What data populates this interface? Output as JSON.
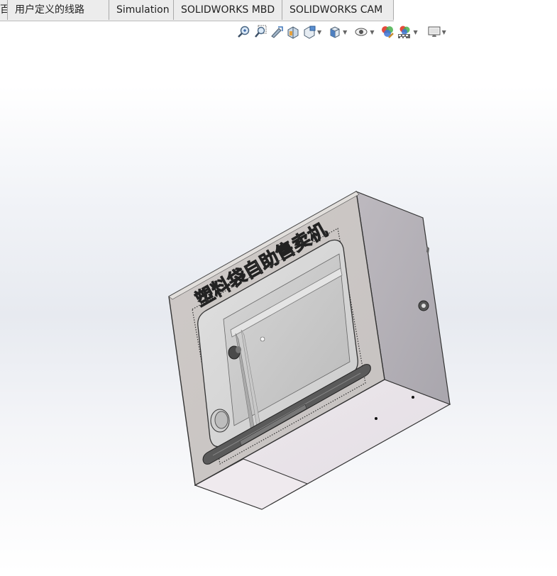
{
  "tabs": [
    {
      "label": "百"
    },
    {
      "label": "用户定义的线路"
    },
    {
      "label": "Simulation"
    },
    {
      "label": "SOLIDWORKS MBD"
    },
    {
      "label": "SOLIDWORKS CAM"
    }
  ],
  "headsup_toolbar": [
    {
      "icon": "zoom-to-fit-icon"
    },
    {
      "icon": "zoom-to-area-icon"
    },
    {
      "icon": "previous-view-icon"
    },
    {
      "icon": "section-view-icon"
    },
    {
      "icon": "dynamic-annotation-icon",
      "dropdown": true
    },
    {
      "icon": "view-orientation-icon",
      "dropdown": true
    },
    {
      "icon": "display-style-icon",
      "dropdown": true
    },
    {
      "icon": "edit-appearance-icon"
    },
    {
      "icon": "apply-scene-icon",
      "dropdown": true
    },
    {
      "icon": "view-settings-icon",
      "dropdown": true
    }
  ],
  "model": {
    "front_label": "塑料袋自助售卖机"
  },
  "colors": {
    "panel_front": "#cfcbc8",
    "panel_side": "#b4b0b5",
    "panel_bottom": "#ede6ea",
    "window_glass": "#d9d9d9"
  }
}
